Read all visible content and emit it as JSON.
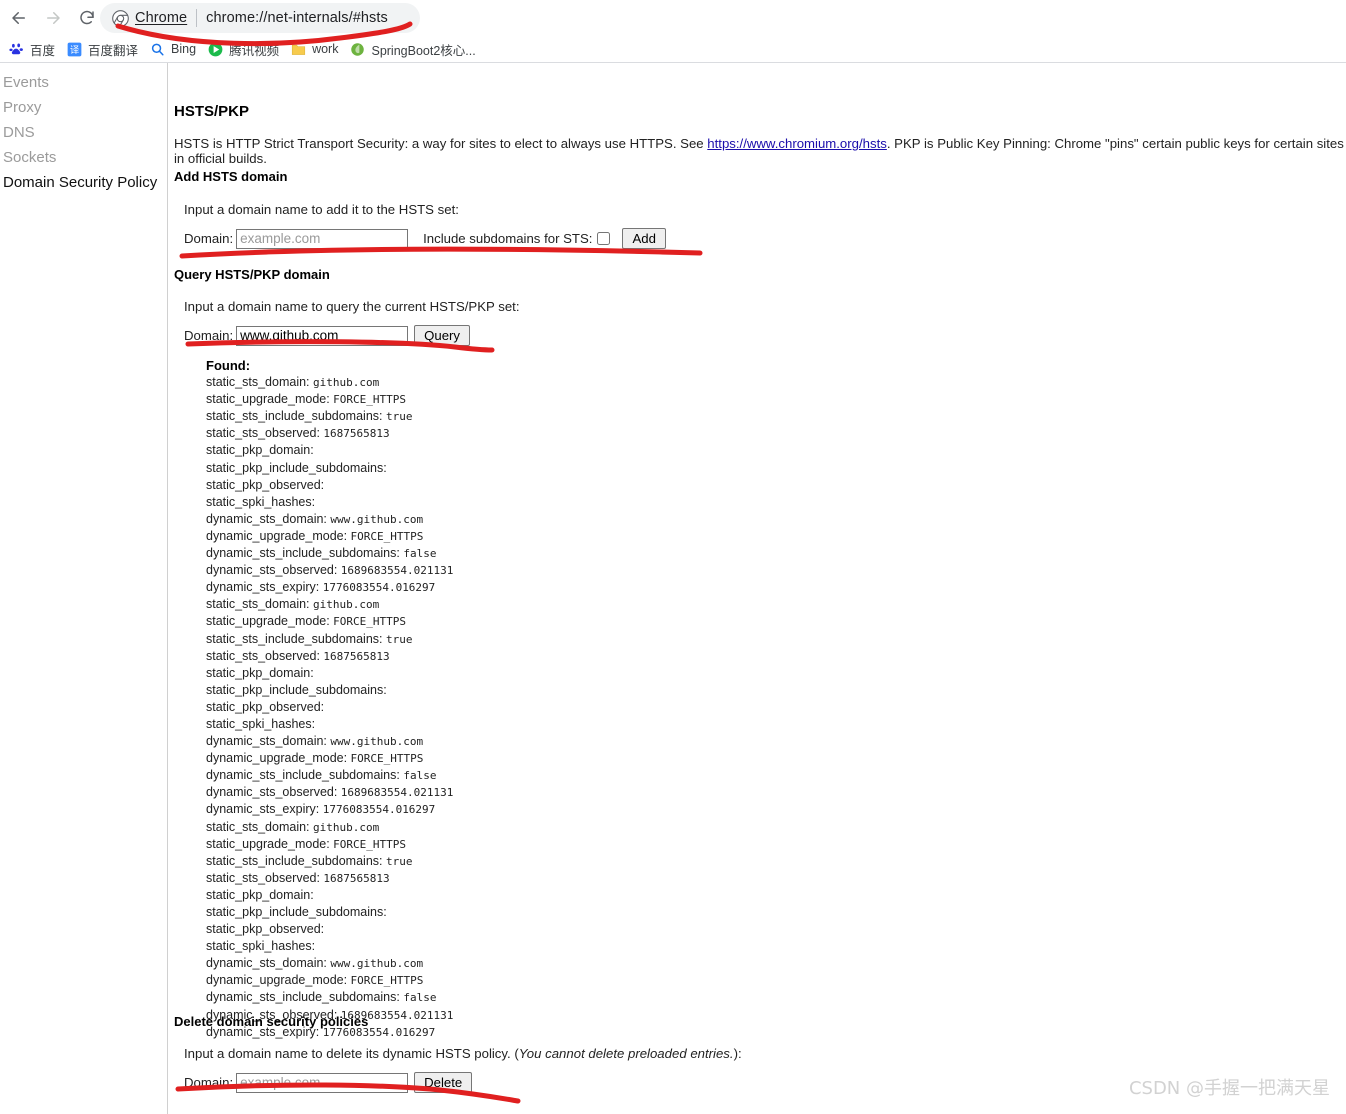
{
  "browser": {
    "back_icon": "back-arrow-icon",
    "forward_icon": "forward-arrow-icon",
    "reload_icon": "reload-icon",
    "omnibox": {
      "chip_icon": "chrome-logo-icon",
      "chip_label": "Chrome",
      "url": "chrome://net-internals/#hsts"
    },
    "bookmarks": [
      {
        "icon": "baidu-icon",
        "label": "百度"
      },
      {
        "icon": "fanyi-icon",
        "label": "百度翻译"
      },
      {
        "icon": "bing-search-icon",
        "label": "Bing"
      },
      {
        "icon": "tencent-video-icon",
        "label": "腾讯视频"
      },
      {
        "icon": "folder-icon",
        "label": "work"
      },
      {
        "icon": "springboot-icon",
        "label": "SpringBoot2核心..."
      }
    ]
  },
  "sidebar": {
    "items": [
      {
        "label": "Events",
        "active": false
      },
      {
        "label": "Proxy",
        "active": false
      },
      {
        "label": "DNS",
        "active": false
      },
      {
        "label": "Sockets",
        "active": false
      },
      {
        "label": "Domain Security Policy",
        "active": true
      }
    ]
  },
  "main": {
    "title": "HSTS/PKP",
    "intro_pre": "HSTS is HTTP Strict Transport Security: a way for sites to elect to always use HTTPS. See ",
    "intro_link": "https://www.chromium.org/hsts",
    "intro_post": ". PKP is Public Key Pinning: Chrome \"pins\" certain public keys for certain sites in official builds.",
    "add_section": {
      "heading": "Add HSTS domain",
      "description": "Input a domain name to add it to the HSTS set:",
      "domain_label": "Domain:",
      "domain_value": "",
      "domain_placeholder": "example.com",
      "checkbox_label": "Include subdomains for STS:",
      "checkbox_checked": false,
      "button_label": "Add"
    },
    "query_section": {
      "heading": "Query HSTS/PKP domain",
      "description": "Input a domain name to query the current HSTS/PKP set:",
      "domain_label": "Domain:",
      "domain_value": "www.github.com",
      "domain_placeholder": "example.com",
      "button_label": "Query"
    },
    "results": {
      "status": "Found:",
      "lines": [
        {
          "key": "static_sts_domain:",
          "value": "github.com"
        },
        {
          "key": "static_upgrade_mode:",
          "value": "FORCE_HTTPS"
        },
        {
          "key": "static_sts_include_subdomains:",
          "value": "true"
        },
        {
          "key": "static_sts_observed:",
          "value": "1687565813"
        },
        {
          "key": "static_pkp_domain:",
          "value": ""
        },
        {
          "key": "static_pkp_include_subdomains:",
          "value": ""
        },
        {
          "key": "static_pkp_observed:",
          "value": ""
        },
        {
          "key": "static_spki_hashes:",
          "value": ""
        },
        {
          "key": "dynamic_sts_domain:",
          "value": "www.github.com"
        },
        {
          "key": "dynamic_upgrade_mode:",
          "value": "FORCE_HTTPS"
        },
        {
          "key": "dynamic_sts_include_subdomains:",
          "value": "false"
        },
        {
          "key": "dynamic_sts_observed:",
          "value": "1689683554.021131"
        },
        {
          "key": "dynamic_sts_expiry:",
          "value": "1776083554.016297"
        },
        {
          "key": "static_sts_domain:",
          "value": "github.com"
        },
        {
          "key": "static_upgrade_mode:",
          "value": "FORCE_HTTPS"
        },
        {
          "key": "static_sts_include_subdomains:",
          "value": "true"
        },
        {
          "key": "static_sts_observed:",
          "value": "1687565813"
        },
        {
          "key": "static_pkp_domain:",
          "value": ""
        },
        {
          "key": "static_pkp_include_subdomains:",
          "value": ""
        },
        {
          "key": "static_pkp_observed:",
          "value": ""
        },
        {
          "key": "static_spki_hashes:",
          "value": ""
        },
        {
          "key": "dynamic_sts_domain:",
          "value": "www.github.com"
        },
        {
          "key": "dynamic_upgrade_mode:",
          "value": "FORCE_HTTPS"
        },
        {
          "key": "dynamic_sts_include_subdomains:",
          "value": "false"
        },
        {
          "key": "dynamic_sts_observed:",
          "value": "1689683554.021131"
        },
        {
          "key": "dynamic_sts_expiry:",
          "value": "1776083554.016297"
        },
        {
          "key": "static_sts_domain:",
          "value": "github.com"
        },
        {
          "key": "static_upgrade_mode:",
          "value": "FORCE_HTTPS"
        },
        {
          "key": "static_sts_include_subdomains:",
          "value": "true"
        },
        {
          "key": "static_sts_observed:",
          "value": "1687565813"
        },
        {
          "key": "static_pkp_domain:",
          "value": ""
        },
        {
          "key": "static_pkp_include_subdomains:",
          "value": ""
        },
        {
          "key": "static_pkp_observed:",
          "value": ""
        },
        {
          "key": "static_spki_hashes:",
          "value": ""
        },
        {
          "key": "dynamic_sts_domain:",
          "value": "www.github.com"
        },
        {
          "key": "dynamic_upgrade_mode:",
          "value": "FORCE_HTTPS"
        },
        {
          "key": "dynamic_sts_include_subdomains:",
          "value": "false"
        },
        {
          "key": "dynamic_sts_observed:",
          "value": "1689683554.021131"
        },
        {
          "key": "dynamic_sts_expiry:",
          "value": "1776083554.016297"
        }
      ]
    },
    "delete_section": {
      "heading": "Delete domain security policies",
      "description_pre": "Input a domain name to delete its dynamic HSTS policy. (",
      "description_em": "You cannot delete preloaded entries.",
      "description_post": "):",
      "domain_label": "Domain:",
      "domain_value": "",
      "domain_placeholder": "example.com",
      "button_label": "Delete"
    }
  },
  "annotation_color": "#e02020",
  "watermark": "CSDN @手握一把满天星"
}
